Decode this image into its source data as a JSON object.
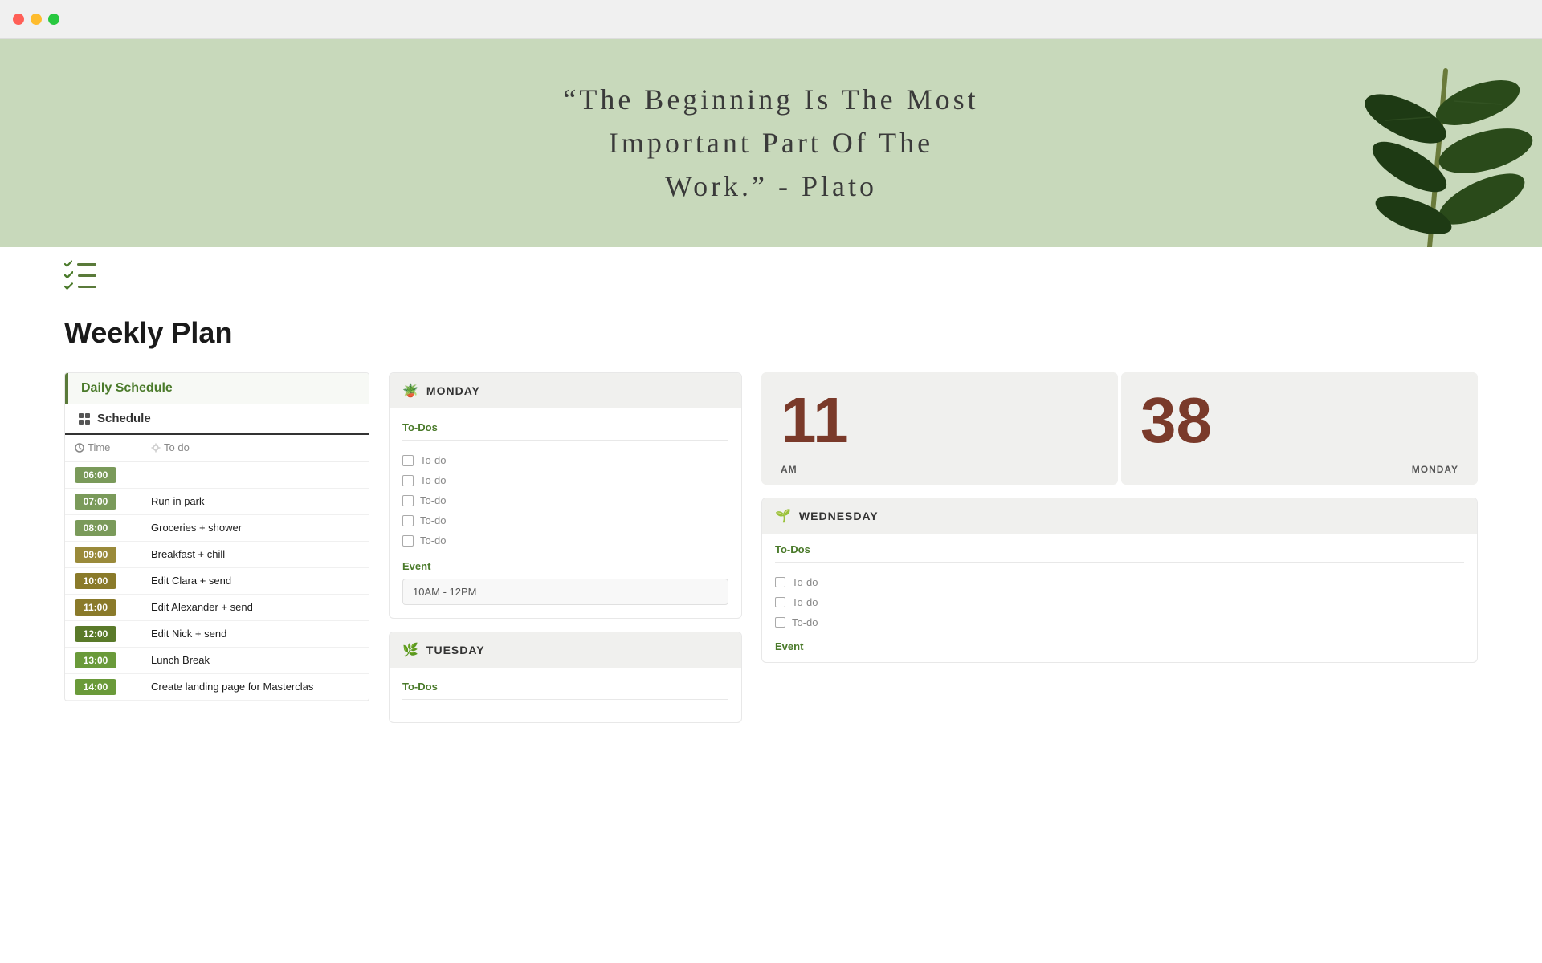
{
  "browser": {
    "traffic_lights": [
      "red",
      "yellow",
      "green"
    ]
  },
  "hero": {
    "quote": "“The Beginning Is The Most\nImportant Part Of The\nWork.” - Plato"
  },
  "page": {
    "title": "Weekly Plan"
  },
  "sidebar": {
    "header": "Daily Schedule",
    "schedule_label": "Schedule",
    "columns": {
      "time_header": "Time",
      "todo_header": "To do"
    },
    "rows": [
      {
        "time": "06:00",
        "color_class": "time-06",
        "task": ""
      },
      {
        "time": "07:00",
        "color_class": "time-07",
        "task": "Run in park"
      },
      {
        "time": "08:00",
        "color_class": "time-08",
        "task": "Groceries + shower"
      },
      {
        "time": "09:00",
        "color_class": "time-09",
        "task": "Breakfast + chill"
      },
      {
        "time": "10:00",
        "color_class": "time-10",
        "task": "Edit Clara + send"
      },
      {
        "time": "11:00",
        "color_class": "time-11",
        "task": "Edit Alexander + send"
      },
      {
        "time": "12:00",
        "color_class": "time-12",
        "task": "Edit Nick + send"
      },
      {
        "time": "13:00",
        "color_class": "time-13",
        "task": "Lunch Break"
      },
      {
        "time": "14:00",
        "color_class": "time-14",
        "task": "Create landing page for Masterclas"
      }
    ]
  },
  "monday": {
    "day": "MONDAY",
    "emoji": "🪴",
    "todos_label": "To-Dos",
    "todos": [
      "To-do",
      "To-do",
      "To-do",
      "To-do",
      "To-do"
    ],
    "event_label": "Event",
    "event_value": "10AM - 12PM"
  },
  "tuesday": {
    "day": "TUESDAY",
    "emoji": "🌿",
    "todos_label": "To-Dos"
  },
  "clock": {
    "hours": "11",
    "minutes": "38",
    "period": "AM",
    "day": "MONDAY"
  },
  "wednesday": {
    "day": "WEDNESDAY",
    "emoji": "🌱",
    "todos_label": "To-Dos",
    "todos": [
      "To-do",
      "To-do",
      "To-do"
    ],
    "event_label": "Event"
  }
}
